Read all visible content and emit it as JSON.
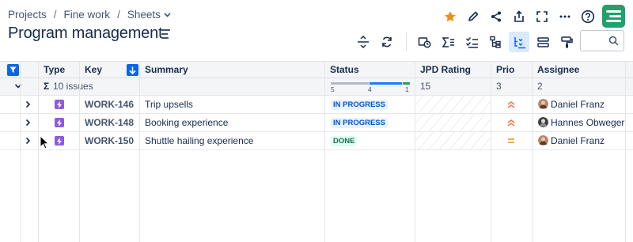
{
  "breadcrumb": {
    "items": [
      "Projects",
      "Fine work",
      "Sheets"
    ],
    "separator": "/"
  },
  "page": {
    "title": "Program management"
  },
  "colors": {
    "accent": "#0c66e4",
    "star": "#f18d13",
    "app_logo": "#22a06b",
    "epic_type": "#8f59e0",
    "prio_high": "#f17b4b",
    "prio_medium": "#e6a53d"
  },
  "top_actions": [
    "star-icon",
    "edit-icon",
    "share-icon",
    "export-icon",
    "fullscreen-icon",
    "more-icon",
    "help-icon",
    "app-logo"
  ],
  "toolbar": {
    "icons": [
      "row-height-icon",
      "refresh-icon",
      "time-tracking-icon",
      "sum-icon",
      "checklist-icon",
      "hierarchy-icon",
      "structure-icon",
      "group-icon",
      "format-painter-icon"
    ],
    "search_placeholder": ""
  },
  "grid": {
    "columns": [
      "Type",
      "Key",
      "Summary",
      "Status",
      "JPD Rating",
      "Prio",
      "Assignee"
    ],
    "summary_row": {
      "label": "10 issues",
      "status_progress": {
        "todo": 5,
        "in_progress": 4,
        "done": 1
      },
      "jpd_total": "15",
      "prio_total": "3",
      "assignee_total": "2"
    },
    "rows": [
      {
        "type": "epic",
        "key": "WORK-146",
        "summary": "Trip upsells",
        "status": "IN PROGRESS",
        "prio": "high",
        "assignee": "Daniel Franz"
      },
      {
        "type": "epic",
        "key": "WORK-148",
        "summary": "Booking experience",
        "status": "IN PROGRESS",
        "prio": "high",
        "assignee": "Hannes Obweger"
      },
      {
        "type": "epic",
        "key": "WORK-150",
        "summary": "Shuttle hailing experience",
        "status": "DONE",
        "prio": "medium",
        "assignee": "Daniel Franz"
      }
    ]
  }
}
